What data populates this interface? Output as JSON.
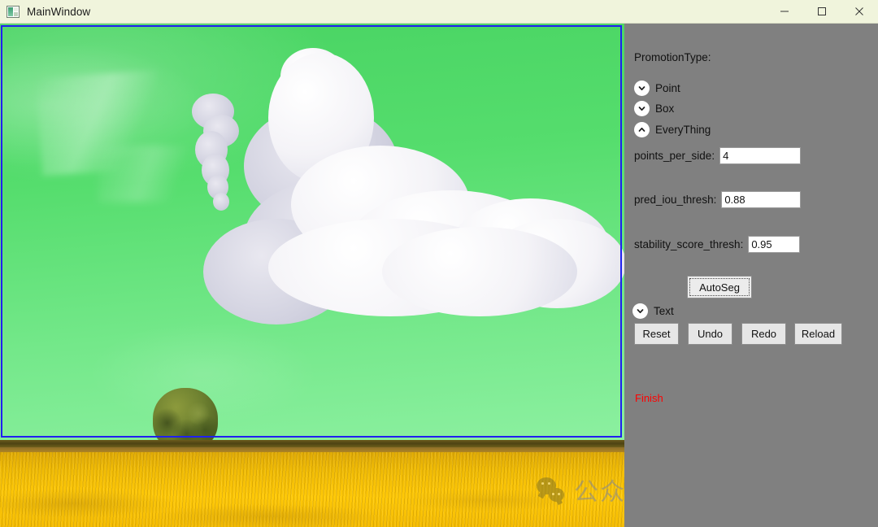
{
  "window": {
    "title": "MainWindow",
    "icon": "app-icon",
    "controls": {
      "minimize": "minimize-icon",
      "maximize": "maximize-icon",
      "close": "close-icon"
    }
  },
  "panel": {
    "promotion_type_label": "PromotionType:",
    "modes": [
      {
        "label": "Point",
        "expanded": false,
        "icon": "chevron-down-icon"
      },
      {
        "label": "Box",
        "expanded": false,
        "icon": "chevron-down-icon"
      },
      {
        "label": "EveryThing",
        "expanded": true,
        "icon": "chevron-up-icon"
      }
    ],
    "text_mode": {
      "label": "Text",
      "expanded": false,
      "icon": "chevron-down-icon"
    },
    "params": [
      {
        "label": "points_per_side:",
        "value": "4"
      },
      {
        "label": "pred_iou_thresh:",
        "value": "0.88"
      },
      {
        "label": "stability_score_thresh:",
        "value": "0.95"
      }
    ],
    "autoseg_button": "AutoSeg",
    "actions": [
      "Reset",
      "Undo",
      "Redo",
      "Reload"
    ],
    "status": "Finish",
    "status_color": "#ff0000",
    "background_color": "#808080"
  },
  "canvas": {
    "selection_border_color": "#2020f0",
    "mask_color": "#55dd6d",
    "description": "Segmented sky mask over landscape photo with clouds, a tree and a yellow rapeseed field"
  },
  "watermark": {
    "text": "公众号 · 十年一梦实验室",
    "logo": "wechat-icon"
  }
}
